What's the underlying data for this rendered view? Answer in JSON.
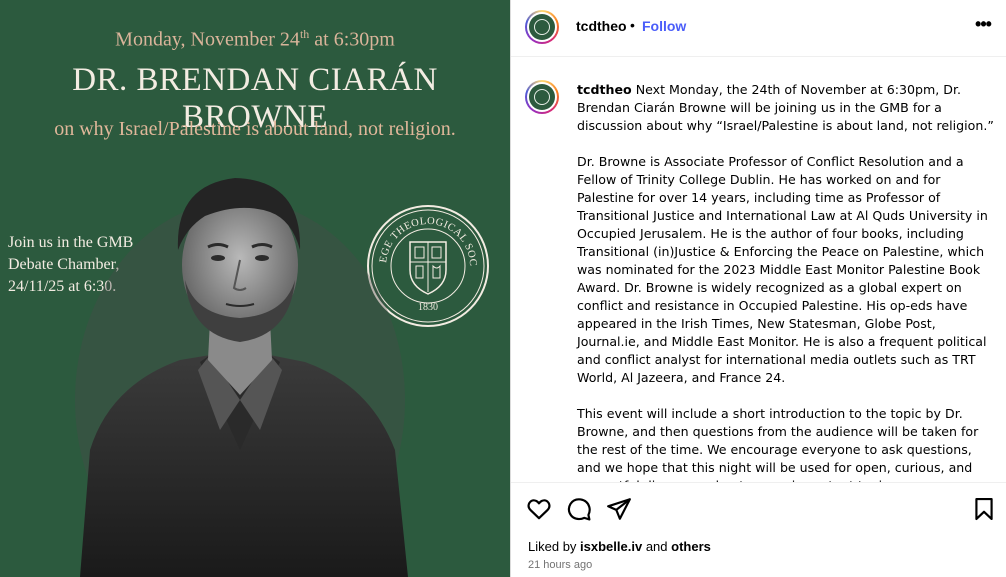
{
  "poster": {
    "date_main": "Monday, November 24",
    "date_sup": "th",
    "date_time": " at 6:30pm",
    "speaker": "DR. BRENDAN CIARÁN BROWNE",
    "topic": "on why Israel/Palestine is about land, not religion.",
    "join_lines": [
      "Join us in the GMB",
      "Debate Chamber,",
      "24/11/25 at 6:30."
    ],
    "seal_text_top": "COLLEGE THEOLOGICAL SOCIETY",
    "seal_year": "1830",
    "background_color": "#2c5a3e"
  },
  "header": {
    "username": "tcdtheo",
    "separator": "•",
    "follow_label": "Follow",
    "more_label": "•••"
  },
  "caption": {
    "username": "tcdtheo",
    "p1": "Next Monday, the 24th of November at 6:30pm, Dr. Brendan Ciarán Browne will be joining us in the GMB for a discussion about why “Israel/Palestine is about land, not religion.”",
    "p2": "Dr. Browne is Associate Professor of Conflict Resolution and a Fellow of Trinity College Dublin. He has worked on and for Palestine for over 14 years, including time as Professor of Transitional Justice and International Law at Al Quds University in Occupied Jerusalem. He is the author of four books, including Transitional (in)Justice & Enforcing the Peace on Palestine, which was nominated for the 2023 Middle East Monitor Palestine Book Award. Dr. Browne is widely recognized as a global expert on conflict and resistance in Occupied Palestine. His op-eds have appeared in the Irish Times, New Statesman, Globe Post, Journal.ie, and Middle East Monitor. He is also a frequent political and conflict analyst for international media outlets such as TRT World, Al Jazeera, and France 24.",
    "p3": "This event will include a short introduction to the topic by Dr. Browne, and then questions from the audience will be taken for the rest of the time. We encourage everyone to ask questions, and we hope that this night will be used for open, curious, and respectful discourse about a very important topic."
  },
  "actions": {
    "icons": [
      "heart-icon",
      "comment-icon",
      "share-icon",
      "bookmark-icon"
    ],
    "liked_prefix": "Liked by ",
    "liked_user": "isxbelle.iv",
    "liked_mid": " and ",
    "liked_others": "others",
    "timestamp": "21 hours ago"
  },
  "colors": {
    "follow_blue": "#4a5df9",
    "timestamp_gray": "#737373"
  }
}
